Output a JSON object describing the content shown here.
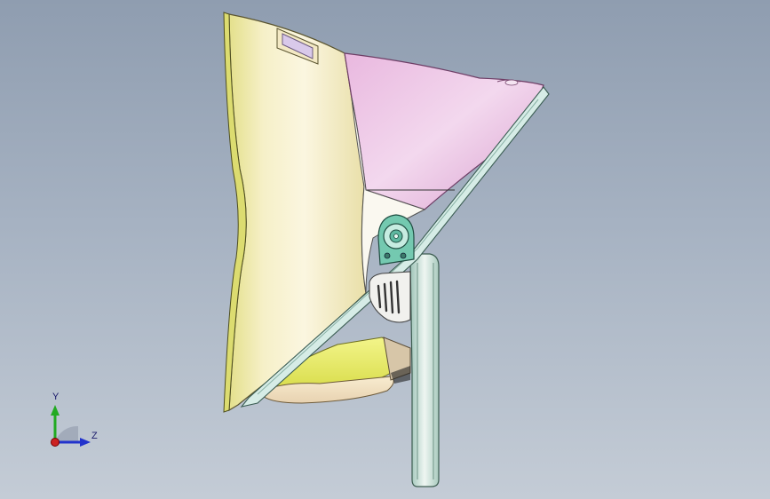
{
  "viewport": {
    "background_top": "#8f9db0",
    "background_bottom": "#c4ccd6"
  },
  "model": {
    "description_colors": {
      "shell_body": "#efe6b0",
      "shell_rim": "#dfe07a",
      "hood": "#e6b8dc",
      "bracket": "#cfe2dc",
      "hinge": "#5fb8a0",
      "base_tray": "#e7ec6a"
    }
  },
  "triad": {
    "y_label": "Y",
    "z_label": "Z",
    "y_color": "#22aa22",
    "z_color": "#2233cc",
    "x_color": "#cc2222"
  }
}
